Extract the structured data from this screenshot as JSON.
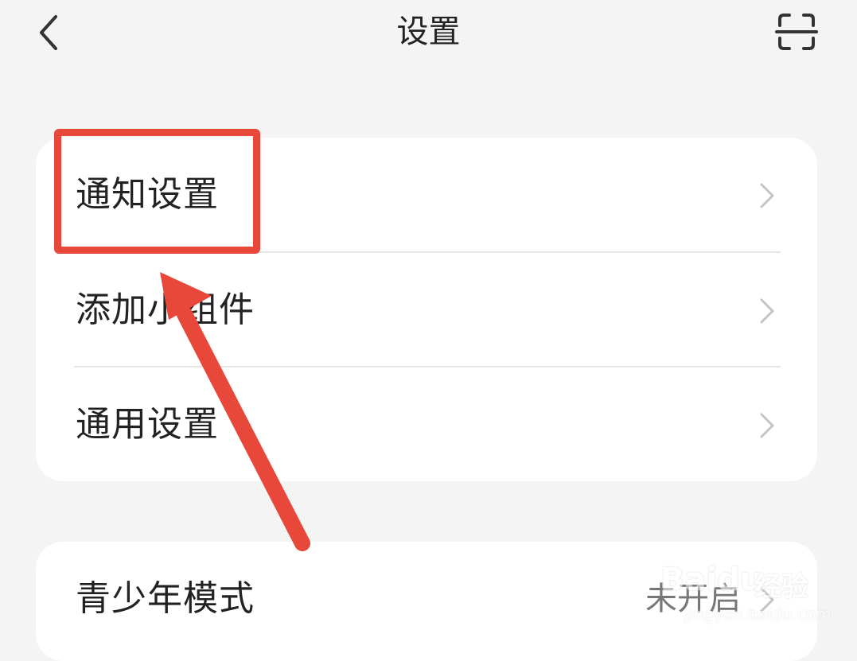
{
  "header": {
    "title": "设置",
    "back_icon": "chevron-left-icon",
    "scan_icon": "scan-icon"
  },
  "settings_group_1": {
    "items": [
      {
        "label": "通知设置",
        "icon": "chevron-right-icon"
      },
      {
        "label": "添加小组件",
        "icon": "chevron-right-icon"
      },
      {
        "label": "通用设置",
        "icon": "chevron-right-icon"
      }
    ]
  },
  "settings_group_2": {
    "items": [
      {
        "label": "青少年模式",
        "value": "未开启",
        "icon": "chevron-right-icon"
      }
    ]
  },
  "annotation": {
    "highlight_color": "#e8483a",
    "arrow_color": "#e8483a"
  },
  "watermark": {
    "brand": "Baidu",
    "brand_cn": "经验",
    "url": "jingyan.baidu.com"
  }
}
